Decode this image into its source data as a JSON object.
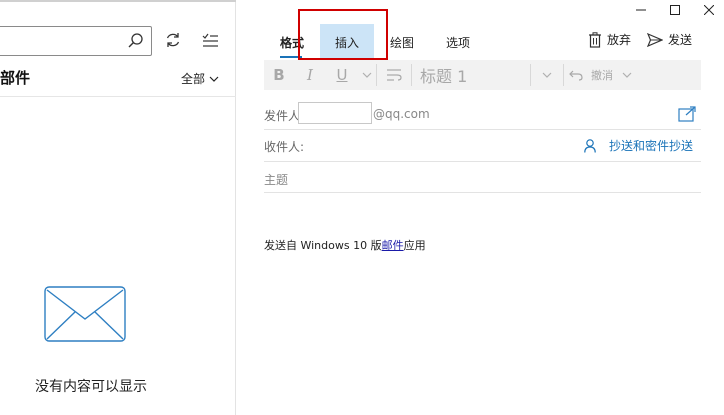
{
  "left": {
    "folder_title": "部件",
    "filter_label": "全部",
    "empty_text": "没有内容可以显示"
  },
  "tabs": [
    {
      "label": "格式"
    },
    {
      "label": "插入"
    },
    {
      "label": "绘图"
    },
    {
      "label": "选项"
    }
  ],
  "actions": {
    "discard": "放弃",
    "send": "发送"
  },
  "toolbar": {
    "bold": "B",
    "italic": "I",
    "underline": "U",
    "heading": "标题 1",
    "undo": "撤消"
  },
  "compose": {
    "from_label": "发件人",
    "from_domain": "@qq.com",
    "to_label": "收件人:",
    "cc_bcc": "抄送和密件抄送",
    "subject_placeholder": "主题",
    "signature_prefix": "发送自 Windows 10 版",
    "signature_link": "邮件",
    "signature_suffix": "应用"
  },
  "colors": {
    "accent": "#1a73b8",
    "tab_selected_bg": "#cce4f7",
    "highlight": "#d00000"
  }
}
